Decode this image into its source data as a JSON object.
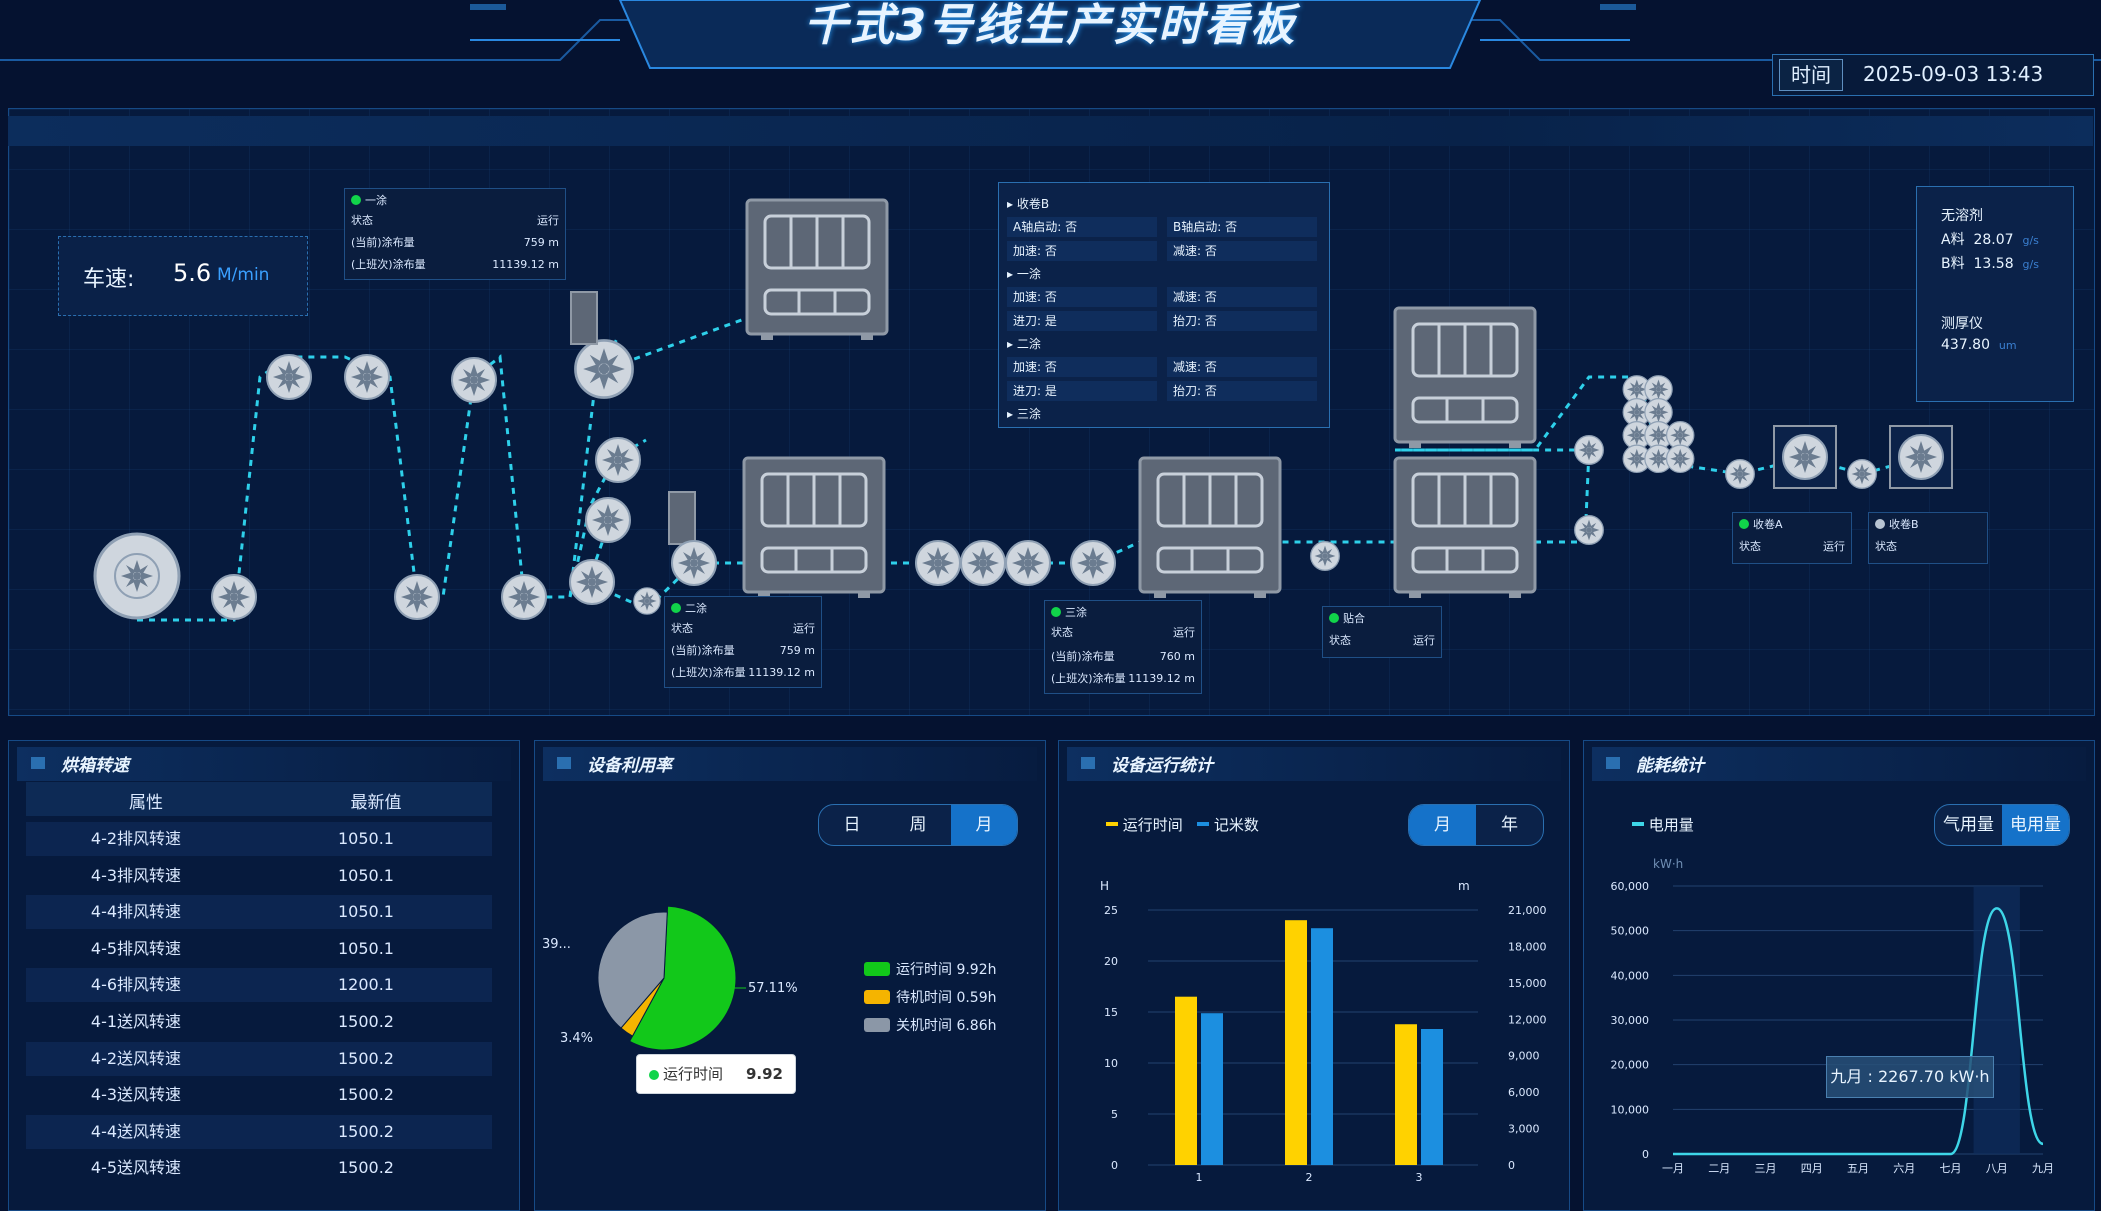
{
  "header": {
    "title": "千式3号线生产实时看板",
    "time_label": "时间",
    "time_value": "2025-09-03  13:43"
  },
  "speed": {
    "label": "车速:",
    "value": "5.6",
    "unit": "M/min"
  },
  "stations": {
    "coat1": {
      "name": "一涂",
      "status_label": "状态",
      "status": "运行",
      "cur_label": "(当前)涂布量",
      "cur": "759 m",
      "prev_label": "(上班次)涂布量",
      "prev": "11139.12 m"
    },
    "coat2": {
      "name": "二涂",
      "status_label": "状态",
      "status": "运行",
      "cur_label": "(当前)涂布量",
      "cur": "759 m",
      "prev_label": "(上班次)涂布量",
      "prev": "11139.12 m"
    },
    "coat3": {
      "name": "三涂",
      "status_label": "状态",
      "status": "运行",
      "cur_label": "(当前)涂布量",
      "cur": "760 m",
      "prev_label": "(上班次)涂布量",
      "prev": "11139.12 m"
    },
    "laminate": {
      "name": "贴合",
      "status_label": "状态",
      "status": "运行"
    },
    "windA": {
      "name": "收卷A",
      "status_label": "状态",
      "status": "运行"
    },
    "windB": {
      "name": "收卷B",
      "status_label": "状态",
      "status": ""
    }
  },
  "params": {
    "sec_wind": "收卷B",
    "a_start": "A轴启动:",
    "a_val": "否",
    "b_start": "B轴启动:",
    "b_val": "否",
    "accel": "加速:",
    "accel_val": "否",
    "decel": "减速:",
    "decel_val": "否",
    "sec_c1": "一涂",
    "c1_accel": "加速:",
    "c1_accel_val": "否",
    "c1_decel": "减速:",
    "c1_decel_val": "否",
    "c1_knife_on": "进刀:",
    "c1_knife_on_val": "是",
    "c1_knife_off": "抬刀:",
    "c1_knife_off_val": "否",
    "sec_c2": "二涂",
    "c2_accel": "加速:",
    "c2_accel_val": "否",
    "c2_decel": "减速:",
    "c2_decel_val": "否",
    "c2_knife_on": "进刀:",
    "c2_knife_on_val": "是",
    "c2_knife_off": "抬刀:",
    "c2_knife_off_val": "否",
    "sec_c3": "三涂"
  },
  "dosing": {
    "title": "无溶剂",
    "a_label": "A料",
    "a_val": "28.07",
    "b_label": "B料",
    "b_val": "13.58",
    "unit": "g/s",
    "gauge_label": "测厚仪",
    "gauge_val": "437.80",
    "gauge_unit": "um"
  },
  "fan": {
    "title": "烘箱转速",
    "col_attr": "属性",
    "col_val": "最新值",
    "rows": [
      {
        "name": "4-2排风转速",
        "val": "1050.1"
      },
      {
        "name": "4-3排风转速",
        "val": "1050.1"
      },
      {
        "name": "4-4排风转速",
        "val": "1050.1"
      },
      {
        "name": "4-5排风转速",
        "val": "1050.1"
      },
      {
        "name": "4-6排风转速",
        "val": "1200.1"
      },
      {
        "name": "4-1送风转速",
        "val": "1500.2"
      },
      {
        "name": "4-2送风转速",
        "val": "1500.2"
      },
      {
        "name": "4-3送风转速",
        "val": "1500.2"
      },
      {
        "name": "4-4送风转速",
        "val": "1500.2"
      },
      {
        "name": "4-5送风转速",
        "val": "1500.2"
      }
    ]
  },
  "util": {
    "title": "设备利用率",
    "tabs": [
      "日",
      "周",
      "月"
    ],
    "active_tab": 2,
    "legend": [
      "运行时间 9.92h",
      "待机时间 0.59h",
      "关机时间 6.86h"
    ],
    "labels": {
      "run_pct": "57.11%",
      "idle_pct": "3.4%",
      "off_pct": "39..."
    },
    "tooltip_label": "运行时间",
    "tooltip_val": "9.92",
    "colors": {
      "run": "#12c81a",
      "idle": "#f5b400",
      "off": "#8b97a7"
    }
  },
  "runstat": {
    "title": "设备运行统计",
    "tabs": [
      "月",
      "年"
    ],
    "active_tab": 0,
    "legend_run": "运行时间",
    "legend_meter": "记米数",
    "ylabel_left": "H",
    "ylabel_right": "m"
  },
  "energy": {
    "title": "能耗统计",
    "tabs": [
      "气用量",
      "电用量"
    ],
    "active_tab": 1,
    "legend": "电用量",
    "unit_label": "kW·h",
    "tooltip": "九月 : 2267.70 kW·h"
  },
  "chart_data": [
    {
      "type": "pie",
      "categories": [
        "运行时间",
        "待机时间",
        "关机时间"
      ],
      "values": [
        9.92,
        0.59,
        6.86
      ],
      "percent_labels": [
        "57.11%",
        "3.4%",
        "39..."
      ]
    },
    {
      "type": "bar",
      "categories": [
        "1",
        "2",
        "3"
      ],
      "series": [
        {
          "name": "运行时间",
          "values": [
            16.5,
            24,
            13.8
          ],
          "axis": "left",
          "color": "#ffd200"
        },
        {
          "name": "记米数",
          "values": [
            12500,
            19500,
            11200
          ],
          "axis": "right",
          "color": "#1c8fe0"
        }
      ],
      "ylim_left": [
        0,
        25
      ],
      "yticks_left": [
        "0",
        "5",
        "10",
        "15",
        "20",
        "25"
      ],
      "ylim_right": [
        0,
        21000
      ],
      "yticks_right": [
        "0",
        "3,000",
        "6,000",
        "9,000",
        "12,000",
        "15,000",
        "18,000",
        "21,000"
      ],
      "ylabel_left": "H",
      "ylabel_right": "m"
    },
    {
      "type": "line",
      "categories": [
        "一月",
        "二月",
        "三月",
        "四月",
        "五月",
        "六月",
        "七月",
        "八月",
        "九月"
      ],
      "series": [
        {
          "name": "电用量",
          "values": [
            0,
            0,
            0,
            0,
            0,
            0,
            0,
            55000,
            2267.7
          ],
          "color": "#3ed6e8"
        }
      ],
      "ylim": [
        0,
        60000
      ],
      "yticks": [
        "0",
        "10,000",
        "20,000",
        "30,000",
        "40,000",
        "50,000",
        "60,000"
      ],
      "ylabel": "kW·h"
    }
  ]
}
